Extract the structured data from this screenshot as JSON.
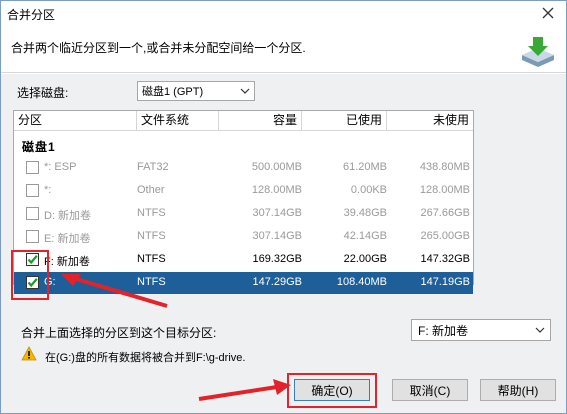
{
  "window": {
    "title": "合并分区"
  },
  "header": {
    "description": "合并两个临近分区到一个,或合并未分配空间给一个分区."
  },
  "disk_selector": {
    "label": "选择磁盘:",
    "value": "磁盘1 (GPT)"
  },
  "table": {
    "columns": [
      "分区",
      "文件系统",
      "容量",
      "已使用",
      "未使用"
    ],
    "group_label": "磁盘1",
    "rows": [
      {
        "name": "*: ESP",
        "fs": "FAT32",
        "capacity": "500.00MB",
        "used": "61.20MB",
        "free": "438.80MB",
        "checked": false,
        "enabled": false,
        "selected": false
      },
      {
        "name": "*:",
        "fs": "Other",
        "capacity": "128.00MB",
        "used": "0.00KB",
        "free": "128.00MB",
        "checked": false,
        "enabled": false,
        "selected": false
      },
      {
        "name": "D: 新加卷",
        "fs": "NTFS",
        "capacity": "307.14GB",
        "used": "39.48GB",
        "free": "267.66GB",
        "checked": false,
        "enabled": false,
        "selected": false
      },
      {
        "name": "E: 新加卷",
        "fs": "NTFS",
        "capacity": "307.14GB",
        "used": "42.14GB",
        "free": "265.00GB",
        "checked": false,
        "enabled": false,
        "selected": false
      },
      {
        "name": "F: 新加卷",
        "fs": "NTFS",
        "capacity": "169.32GB",
        "used": "22.00GB",
        "free": "147.32GB",
        "checked": true,
        "enabled": true,
        "selected": false
      },
      {
        "name": "G:",
        "fs": "NTFS",
        "capacity": "147.29GB",
        "used": "108.40MB",
        "free": "147.19GB",
        "checked": true,
        "enabled": true,
        "selected": true
      }
    ]
  },
  "target": {
    "label": "合并上面选择的分区到这个目标分区:",
    "value": "F: 新加卷"
  },
  "warning": {
    "text": "在(G:)盘的所有数据将被合并到F:\\g-drive."
  },
  "buttons": {
    "ok": "确定(O)",
    "cancel": "取消(C)",
    "help": "帮助(H)"
  },
  "colors": {
    "selected_row": "#1f5f99",
    "annotation_red": "#e2232a"
  },
  "icons": {
    "close": "close-icon",
    "header": "merge-partition-icon",
    "warning": "warning-icon",
    "checkbox": "checkmark-icon"
  }
}
